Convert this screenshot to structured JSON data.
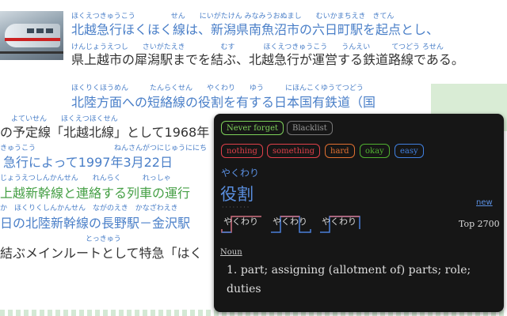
{
  "article": {
    "lines": [
      {
        "ruby": "ほくえつきゅうこう　　　　　せん　　にいがたけん みなみうおぬまし　　むいかまちえき　きてん",
        "text": "北越急行ほくほく線は、新潟県南魚沼市の六日町駅を起点とし、"
      },
      {
        "ruby": "けんじょうえつし　　さいがたえき　　　　　むす　　　　ほくえつきゅうこう　　うんえい　　　てつどう ろせん",
        "text": "県上越市の犀潟駅までを結ぶ、北越急行が運営する鉄道路線である。"
      },
      {
        "ruby": "ほくりくほうめん　　　たんらくせん　　やくわり　　ゆう　　　にほんこくゆうてつどう",
        "text": "北陸方面への短絡線の役割を有する日本国有鉄道（国"
      },
      {
        "ruby": "よていせん　　ほくえつほくせん",
        "text": "の予定線「北越北線」として1968年"
      },
      {
        "ruby": "きゅうこう　　　　　　　　　　　ねんさんがつにじゅうににち",
        "text": "急行によって1997年3月22日"
      },
      {
        "ruby": "じょうえつしんかんせん　　れんらく　　　れっしゃ",
        "text": "上越新幹線と連絡する列車の運行"
      },
      {
        "ruby": "か　ほくりくしんかんせん　ながのえき　かなざわえき",
        "text": "日の北陸新幹線の長野駅－金沢駅"
      },
      {
        "ruby": "　　　　　　　　　　　　とっきゅう",
        "text": "結ぶメインルートとして特急「はく"
      }
    ]
  },
  "popup": {
    "tags": {
      "never_forget": "Never forget",
      "blacklist": "Blacklist"
    },
    "ratings": [
      "nothing",
      "something",
      "hard",
      "okay",
      "easy"
    ],
    "rating_colors": {
      "nothing": "#e0404a",
      "something": "#e0404a",
      "hard": "#e07030",
      "okay": "#50b030",
      "easy": "#4080e0"
    },
    "reading": "やくわり",
    "word": "役割",
    "new_label": "new",
    "pitch_patterns": [
      "やくわり",
      "やくわり",
      "やくわり"
    ],
    "frequency": "Top 2700",
    "part_of_speech": "Noun",
    "definition_number": "1.",
    "definition": "part; assigning (allotment of) parts; role; duties"
  }
}
